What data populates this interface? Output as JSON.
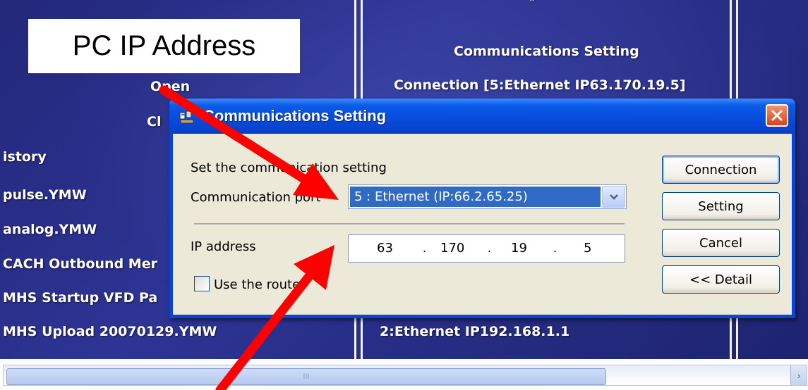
{
  "background": {
    "pc_ip_label": "PC IP Address",
    "menu": {
      "open": "Open",
      "close": "Cl"
    },
    "history_items": [
      "istory",
      "pulse.YMW",
      "analog.YMW",
      "CACH Outbound Mer",
      "MHS Startup VFD Pa",
      "MHS Upload 20070129.YMW"
    ],
    "right_panel": {
      "title": "Communications Setting",
      "connection": "Connection [5:Ethernet IP63.170.19.5]",
      "bottom_item": "2:Ethernet IP192.168.1.1"
    },
    "quote_mark": "”"
  },
  "dialog": {
    "title": "Communications Setting",
    "close_symbol": "✕",
    "instruction": "Set the communication setting",
    "port_label": "Communication port",
    "port_value": "5 : Ethernet (IP:66.2.65.25)",
    "ip_label": "IP address",
    "ip": [
      "63",
      "170",
      "19",
      "5"
    ],
    "router_label": "Use the router",
    "router_checked": false,
    "buttons": {
      "connection": "Connection",
      "setting": "Setting",
      "cancel": "Cancel",
      "detail": "<< Detail"
    }
  },
  "scrollbar": {
    "grip": "III",
    "right_arrow": "›"
  },
  "colors": {
    "arrow": "#ff0000",
    "titlebar": "#0748d8",
    "selection": "#316ac5",
    "close_button": "#d64420"
  }
}
